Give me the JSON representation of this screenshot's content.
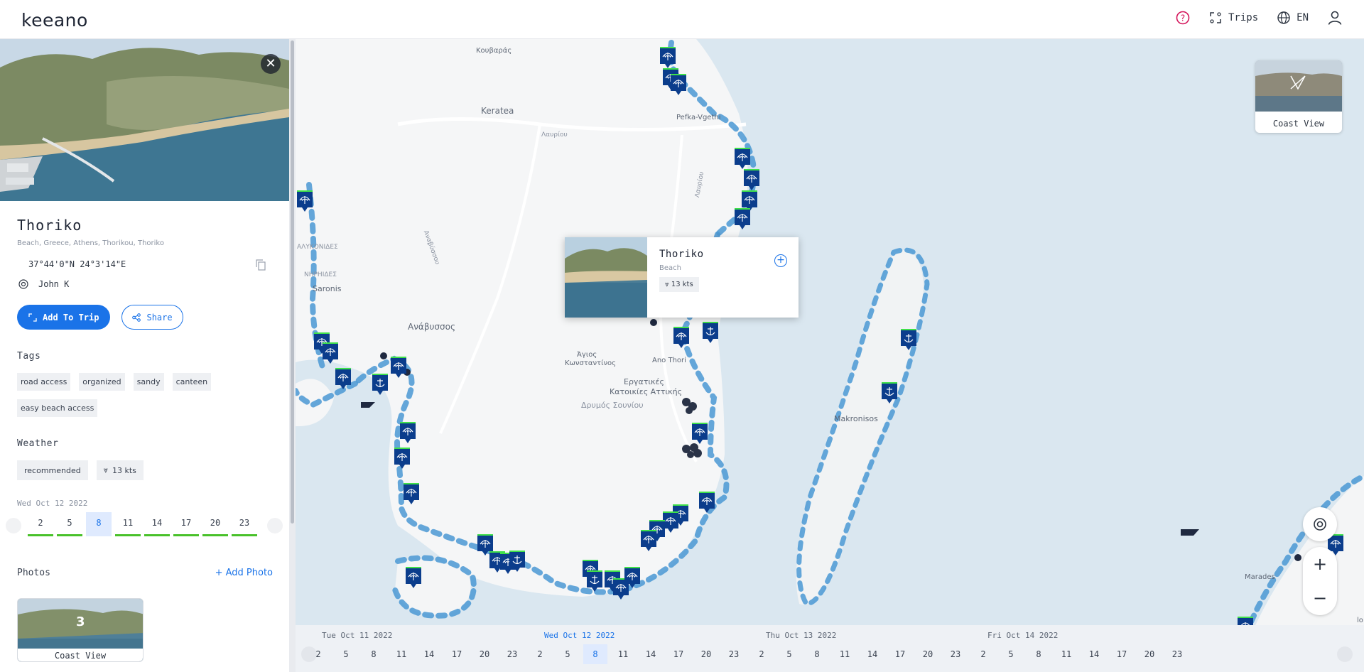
{
  "app": {
    "logo": "keeano",
    "accent": "#1a73e8",
    "wind_ok": "#49c12a"
  },
  "header": {
    "help_icon": "help-icon",
    "trips_label": "Trips",
    "language": "EN"
  },
  "place": {
    "title": "Thoriko",
    "path": "Beach, Greece, Athens, Thorikou, Thoriko",
    "coords": "37°44'0\"N 24°3'14\"E",
    "author": "John K",
    "add_to_trip": "Add To Trip",
    "share": "Share"
  },
  "tags": {
    "title": "Tags",
    "items": [
      "road access",
      "organized",
      "sandy",
      "canteen",
      "easy beach access"
    ]
  },
  "weather": {
    "title": "Weather",
    "status": "recommended",
    "wind": "13 kts",
    "date": "Wed Oct 12 2022",
    "hours": [
      "2",
      "5",
      "8",
      "11",
      "14",
      "17",
      "20",
      "23"
    ],
    "active_hour": "8"
  },
  "photos": {
    "title": "Photos",
    "add_label": "Add Photo",
    "card_count": "3",
    "card_label": "Coast View"
  },
  "popup": {
    "title": "Thoriko",
    "type": "Beach",
    "wind": "13 kts"
  },
  "coast_view": {
    "label": "Coast View"
  },
  "map_labels": [
    "Κουβαράς",
    "Keratea",
    "Λαυρίου",
    "Pefka-Vgethi",
    "Λαυρίου",
    "Αναβύσσου",
    "ΑΛΥΚΟΝΙΔΕΣ",
    "ΝΗΡΗΙΔΕΣ",
    "Saronis",
    "Ανάβυσσος",
    "Άγιος",
    "Κωνσταντίνος",
    "Ano Thori",
    "Εργατικές",
    "Κατοικίες Αττικής",
    "Δρυμός Σουνίου",
    "Makronisos",
    "Marades",
    "lo"
  ],
  "timeline": {
    "days": [
      {
        "label": "Tue Oct 11 2022",
        "hours": [
          "2",
          "5",
          "8",
          "11",
          "14",
          "17",
          "20",
          "23"
        ]
      },
      {
        "label": "Wed Oct 12 2022",
        "hours": [
          "2",
          "5",
          "8",
          "11",
          "14",
          "17",
          "20",
          "23"
        ]
      },
      {
        "label": "Thu Oct 13 2022",
        "hours": [
          "2",
          "5",
          "8",
          "11",
          "14",
          "17",
          "20",
          "23"
        ]
      },
      {
        "label": "Fri Oct 14 2022",
        "hours": [
          "2",
          "5",
          "8",
          "11",
          "14",
          "17",
          "20",
          "23"
        ]
      }
    ],
    "current_day": "Wed Oct 12 2022",
    "active_hour": "8"
  }
}
